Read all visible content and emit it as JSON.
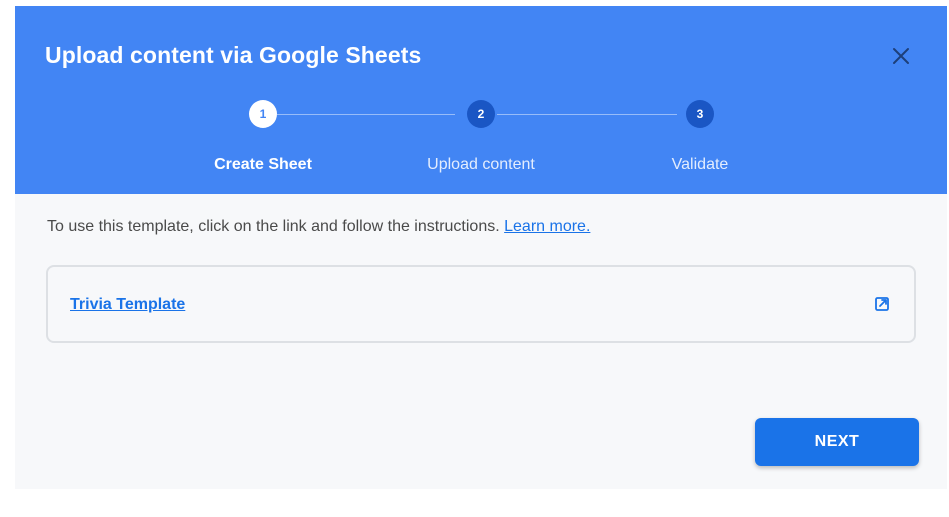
{
  "dialog": {
    "title": "Upload content via Google Sheets",
    "close_icon": "close-icon"
  },
  "stepper": {
    "steps": [
      {
        "number": "1",
        "label": "Create Sheet",
        "state": "active"
      },
      {
        "number": "2",
        "label": "Upload content",
        "state": "inactive"
      },
      {
        "number": "3",
        "label": "Validate",
        "state": "inactive"
      }
    ]
  },
  "body": {
    "instructions": "To use this template, click on the link and follow the instructions.",
    "learn_more": "Learn more."
  },
  "template": {
    "link_text": "Trivia Template",
    "icon": "external-link-icon"
  },
  "actions": {
    "next_label": "NEXT"
  },
  "colors": {
    "header": "#4285f4",
    "primary_button": "#1a73e8",
    "inactive_step": "#1a56c4"
  }
}
